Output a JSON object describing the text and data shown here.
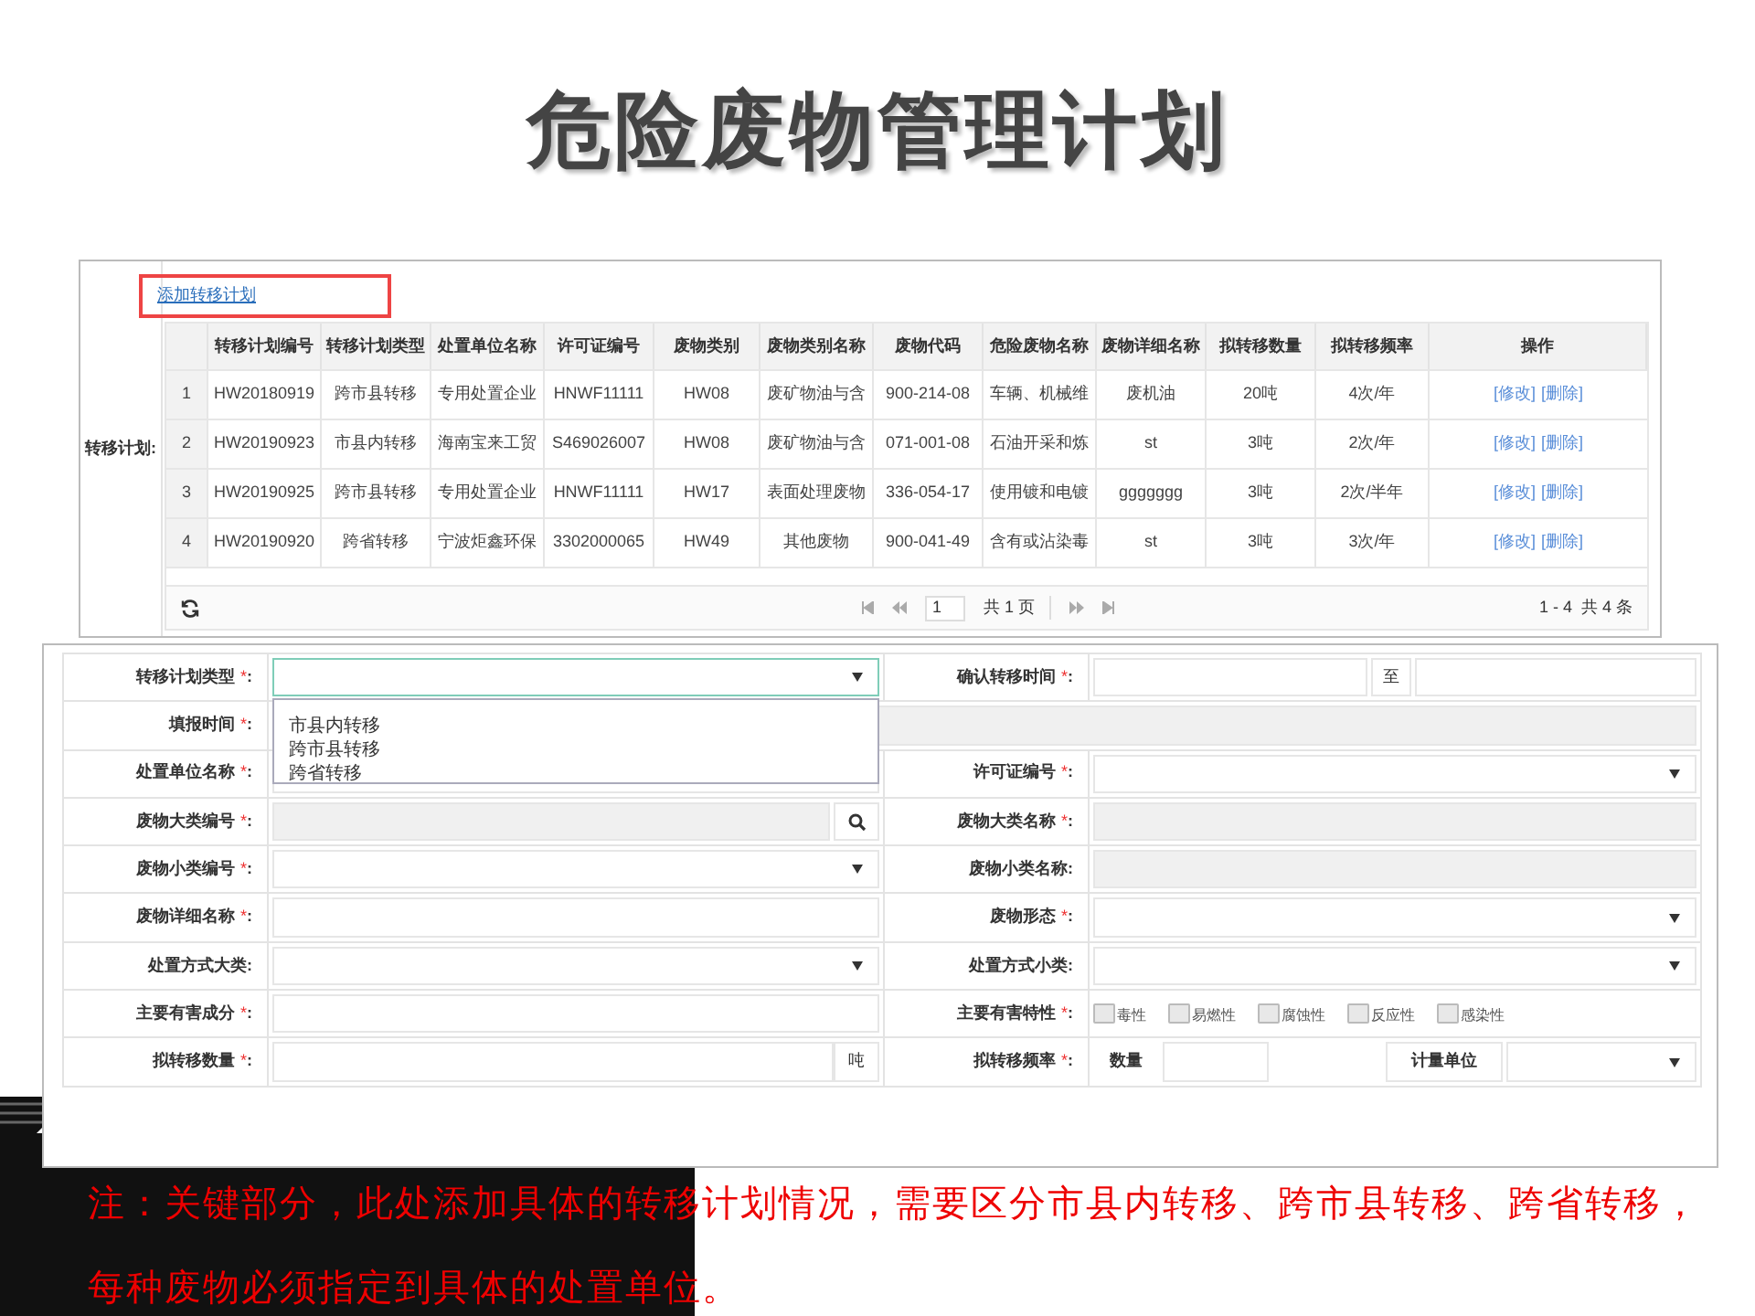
{
  "title": "危险废物管理计划",
  "transfer_plan": {
    "label": "转移计划:",
    "add_link": "添加转移计划",
    "table": {
      "columns": [
        "",
        "转移计划编号",
        "转移计划类型",
        "处置单位名称",
        "许可证编号",
        "废物类别",
        "废物类别名称",
        "废物代码",
        "危险废物名称",
        "废物详细名称",
        "拟转移数量",
        "拟转移频率",
        "操作"
      ],
      "rows": [
        {
          "cells": [
            "1",
            "HW20180919",
            "跨市县转移",
            "专用处置企业",
            "HNWF11111",
            "HW08",
            "废矿物油与含",
            "900-214-08",
            "车辆、机械维",
            "废机油",
            "20吨",
            "4次/年"
          ],
          "actions": [
            "[修改]",
            "[删除]"
          ]
        },
        {
          "cells": [
            "2",
            "HW20190923",
            "市县内转移",
            "海南宝来工贸",
            "S469026007",
            "HW08",
            "废矿物油与含",
            "071-001-08",
            "石油开采和炼",
            "st",
            "3吨",
            "2次/年"
          ],
          "actions": [
            "[修改]",
            "[删除]"
          ]
        },
        {
          "cells": [
            "3",
            "HW20190925",
            "跨市县转移",
            "专用处置企业",
            "HNWF11111",
            "HW17",
            "表面处理废物",
            "336-054-17",
            "使用镀和电镀",
            "ggggggg",
            "3吨",
            "2次/半年"
          ],
          "actions": [
            "[修改]",
            "[删除]"
          ]
        },
        {
          "cells": [
            "4",
            "HW20190920",
            "跨省转移",
            "宁波炬鑫环保",
            "3302000065",
            "HW49",
            "其他废物",
            "900-041-49",
            "含有或沾染毒",
            "st",
            "3吨",
            "3次/年"
          ],
          "actions": [
            "[修改]",
            "[删除]"
          ]
        }
      ]
    },
    "pager": {
      "page": "1",
      "total_pages": "共 1 页",
      "summary": "1 - 4  共 4 条"
    }
  },
  "form": {
    "required_mark": "*",
    "colon": ":",
    "rows": [
      {
        "left": {
          "label": "转移计划类型",
          "required": true,
          "kind": "select",
          "open": true,
          "options": [
            "市县内转移",
            "跨市县转移",
            "跨省转移"
          ]
        },
        "right": {
          "label": "确认转移时间",
          "required": true,
          "kind": "date_range",
          "separator": "至"
        }
      },
      {
        "left": {
          "label": "填报时间",
          "required": true,
          "kind": "readonly_wide"
        }
      },
      {
        "left": {
          "label": "处置单位名称",
          "required": true,
          "kind": "text"
        },
        "right": {
          "label": "许可证编号",
          "required": true,
          "kind": "select"
        }
      },
      {
        "left": {
          "label": "废物大类编号",
          "required": true,
          "kind": "search"
        },
        "right": {
          "label": "废物大类名称",
          "required": true,
          "kind": "readonly"
        }
      },
      {
        "left": {
          "label": "废物小类编号",
          "required": true,
          "kind": "select"
        },
        "right": {
          "label": "废物小类名称",
          "required": false,
          "kind": "readonly"
        }
      },
      {
        "left": {
          "label": "废物详细名称",
          "required": true,
          "kind": "text"
        },
        "right": {
          "label": "废物形态",
          "required": true,
          "kind": "select"
        }
      },
      {
        "left": {
          "label": "处置方式大类",
          "required": false,
          "kind": "select"
        },
        "right": {
          "label": "处置方式小类",
          "required": false,
          "kind": "select"
        }
      },
      {
        "left": {
          "label": "主要有害成分",
          "required": true,
          "kind": "text"
        },
        "right": {
          "label": "主要有害特性",
          "required": true,
          "kind": "checkboxes",
          "options": [
            {
              "label": "毒性",
              "checked": false
            },
            {
              "label": "易燃性",
              "checked": false
            },
            {
              "label": "腐蚀性",
              "checked": false
            },
            {
              "label": "反应性",
              "checked": false
            },
            {
              "label": "感染性",
              "checked": false
            }
          ]
        }
      },
      {
        "left": {
          "label": "拟转移数量",
          "required": true,
          "kind": "unit",
          "unit": "吨"
        },
        "right": {
          "label": "拟转移频率",
          "required": true,
          "kind": "frequency",
          "quantity_label": "数量",
          "unit_label": "计量单位"
        }
      }
    ]
  },
  "note": "注：关键部分，此处添加具体的转移计划情况，需要区分市县内转移、跨市县转移、跨省转移，每种废物必须指定到具体的处置单位。"
}
